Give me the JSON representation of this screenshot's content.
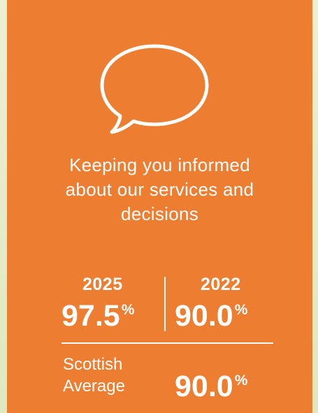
{
  "colors": {
    "card_background": "#ed7d31",
    "page_background": "#e6ecc9",
    "text": "#ffffff"
  },
  "icon": "speech-bubble-icon",
  "title": {
    "line1": "Keeping you informed",
    "line2": "about our services and",
    "line3": "decisions"
  },
  "results": {
    "year_2025": {
      "label": "2025",
      "value": "97.5",
      "unit": "%"
    },
    "year_2022": {
      "label": "2022",
      "value": "90.0",
      "unit": "%"
    },
    "scottish_average": {
      "label_line1": "Scottish",
      "label_line2": "Average",
      "value": "90.0",
      "unit": "%"
    }
  }
}
